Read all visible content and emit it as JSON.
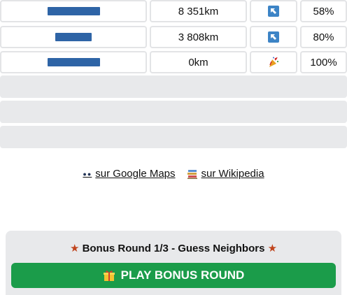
{
  "guesses": [
    {
      "name": "",
      "distance": "8 351km",
      "direction_icon": "north-west-arrow-icon",
      "proximity": "58%"
    },
    {
      "name": "",
      "distance": "3 808km",
      "direction_icon": "north-west-arrow-icon",
      "proximity": "80%"
    },
    {
      "name": "",
      "distance": "0km",
      "direction_icon": "party-popper-icon",
      "proximity": "100%"
    }
  ],
  "empty_rows": 3,
  "links": {
    "maps_label": "sur Google Maps",
    "wiki_label": "sur Wikipedia"
  },
  "bonus": {
    "star": "★",
    "title": "Bonus Round 1/3 - Guess Neighbors",
    "play_label": "PLAY BONUS ROUND"
  },
  "colors": {
    "redaction": "#2e64a6",
    "arrow_tile": "#3d84c6",
    "play_button": "#1b9c4a",
    "star": "#c0441c"
  }
}
